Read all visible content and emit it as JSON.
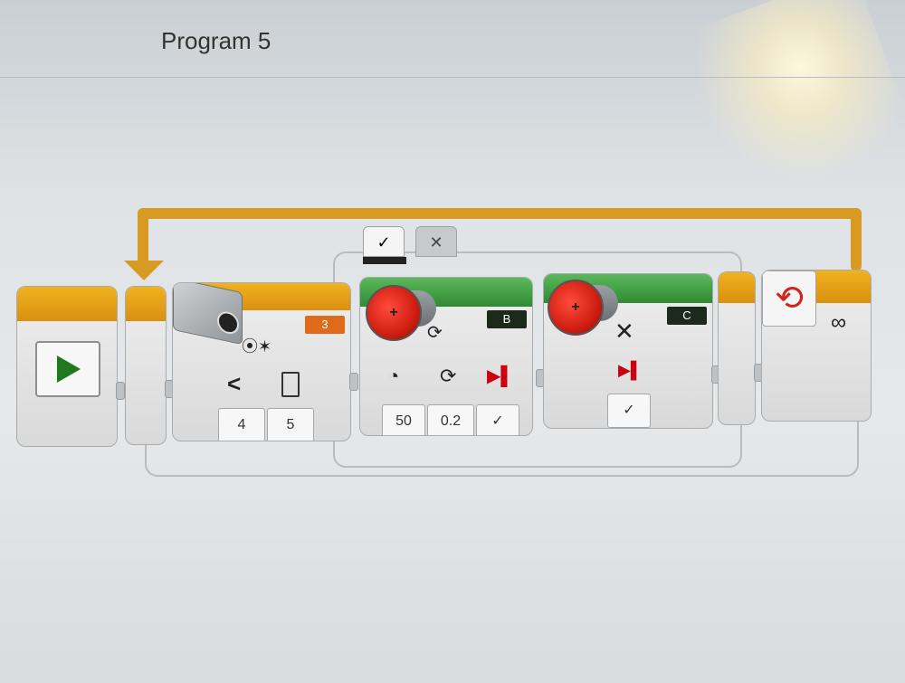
{
  "window": {
    "title": "Program 5"
  },
  "colors": {
    "flow_orange": "#d89a22",
    "motor_green": "#2f8a33",
    "motor_red": "#d01e12",
    "port_orange": "#e06a1b",
    "play_green": "#1f7a1f"
  },
  "loop": {
    "count_symbol": "∞",
    "icon": "loop-icon"
  },
  "switch_tabs": [
    {
      "label": "✓",
      "state": "active"
    },
    {
      "label": "✕",
      "state": "inactive"
    }
  ],
  "sensor_block": {
    "icon": "color-sensor-icon",
    "port": "3",
    "compare_symbol": "<",
    "params": [
      "4",
      "5"
    ]
  },
  "motor_b_block": {
    "icon": "large-motor-icon",
    "port": "B",
    "mode_icon": "rotations-icon",
    "param_icons": [
      "speed-icon",
      "rotations-icon",
      "brake-icon"
    ],
    "params": [
      "50",
      "0.2",
      "✓"
    ]
  },
  "motor_c_block": {
    "icon": "large-motor-icon",
    "port": "C",
    "mode_symbol": "✕",
    "param_icon": "brake-icon",
    "param": "✓"
  }
}
